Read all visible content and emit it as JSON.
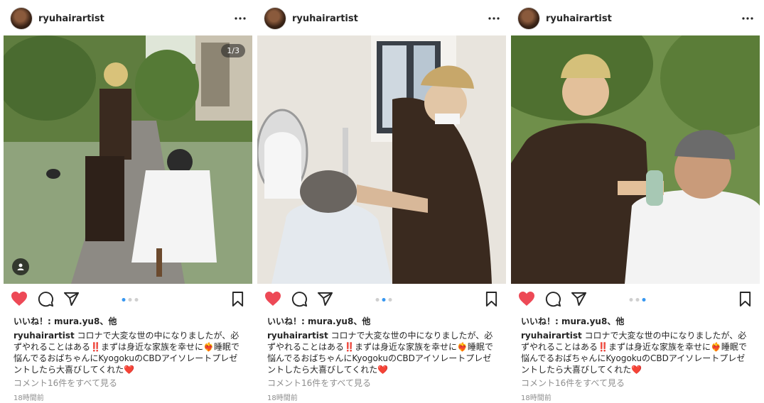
{
  "posts": [
    {
      "username": "ryuhairartist",
      "counter": "1/3",
      "active_dot": 0,
      "likes_prefix": "いいね！: ",
      "likes_name": "mura.yu8",
      "likes_suffix": "、他",
      "caption_user": "ryuhairartist",
      "caption_text": " コロナで大変な世の中になりましたが、必ずやれることはある‼️まずは身近な家族を幸せに❤️‍🔥睡眠で悩んでるおばちゃんにKyogokuのCBDアイソレートプレゼントしたら大喜びしてくれた❤️",
      "view_comments": "コメント16件をすべて見る",
      "time": "18時間前"
    },
    {
      "username": "ryuhairartist",
      "active_dot": 1,
      "likes_prefix": "いいね！: ",
      "likes_name": "mura.yu8",
      "likes_suffix": "、他",
      "caption_user": "ryuhairartist",
      "caption_text": " コロナで大変な世の中になりましたが、必ずやれることはある‼️まずは身近な家族を幸せに❤️‍🔥睡眠で悩んでるおばちゃんにKyogokuのCBDアイソレートプレゼントしたら大喜びしてくれた❤️",
      "view_comments": "コメント16件をすべて見る",
      "time": "18時間前"
    },
    {
      "username": "ryuhairartist",
      "active_dot": 2,
      "likes_prefix": "いいね！: ",
      "likes_name": "mura.yu8",
      "likes_suffix": "、他",
      "caption_user": "ryuhairartist",
      "caption_text": " コロナで大変な世の中になりましたが、必ずやれることはある‼️まずは身近な家族を幸せに❤️‍🔥睡眠で悩んでるおばちゃんにKyogokuのCBDアイソレートプレゼントしたら大喜びしてくれた❤️",
      "view_comments": "コメント16件をすべて見る",
      "time": "18時間前"
    }
  ],
  "icons": {
    "like": "heart-icon",
    "comment": "comment-icon",
    "share": "share-icon",
    "save": "bookmark-icon",
    "more": "more-icon",
    "tag": "user-tag-icon"
  },
  "colors": {
    "heart": "#ed4956",
    "active_dot": "#3897f0",
    "text": "#262626",
    "muted": "#8e8e8e"
  }
}
